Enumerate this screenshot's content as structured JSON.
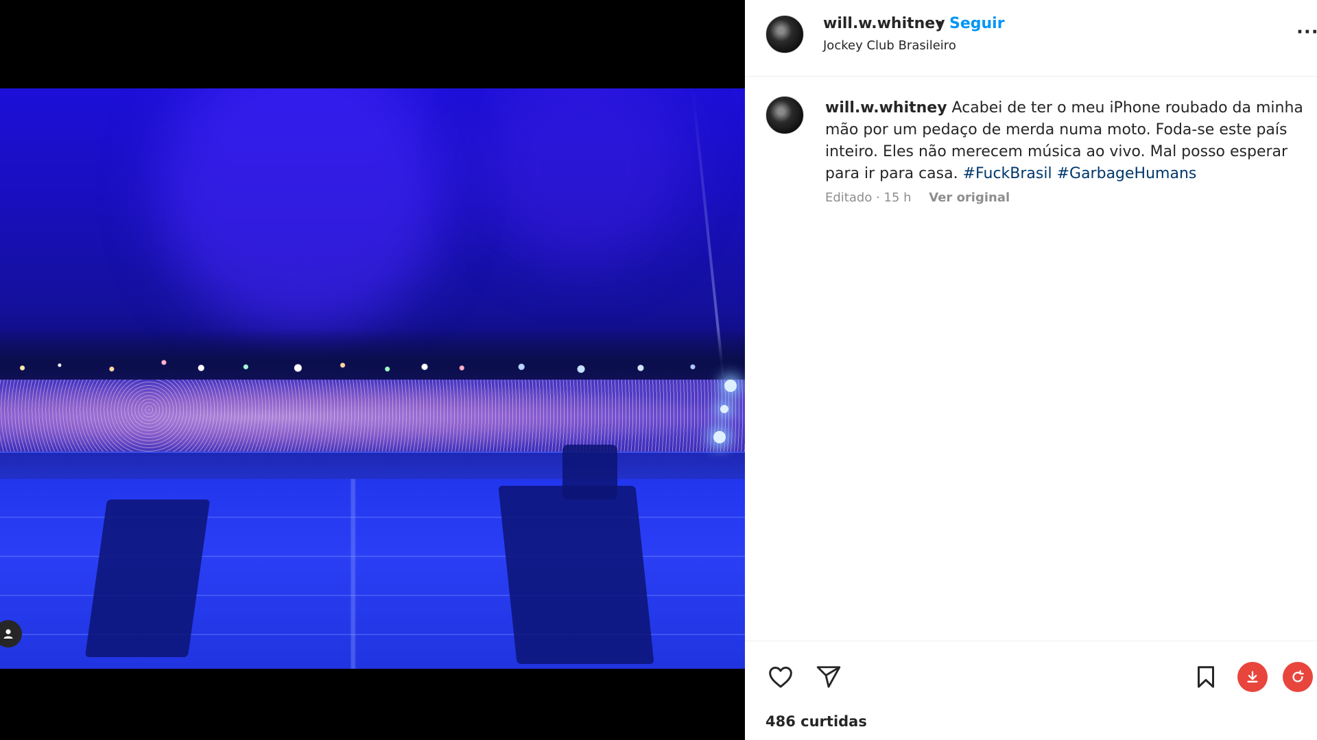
{
  "post": {
    "username": "will.w.whitney",
    "separator": "•",
    "follow_label": "Seguir",
    "location": "Jockey Club Brasileiro",
    "more_icon": "more-options-icon"
  },
  "caption": {
    "username": "will.w.whitney",
    "text": "Acabei de ter o meu iPhone roubado da minha mão por um pedaço de merda numa moto. Foda-se este país inteiro. Eles não merecem música ao vivo. Mal posso esperar para ir para casa.",
    "hashtags": [
      "#FuckBrasil",
      "#GarbageHumans"
    ],
    "meta": "Editado · 15 h",
    "see_original": "Ver original"
  },
  "actions": {
    "icons": [
      "heart-icon",
      "send-icon",
      "bookmark-icon",
      "download-icon"
    ],
    "likes": "486 curtidas"
  },
  "colors": {
    "accent": "#0095f6",
    "hashtag": "#00376b",
    "muted": "#8e8e8e",
    "download": "#e8453c"
  }
}
